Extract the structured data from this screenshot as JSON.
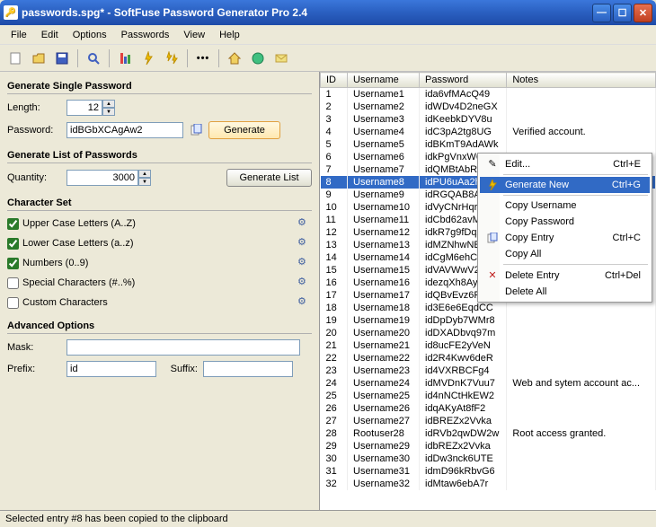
{
  "title": "passwords.spg* - SoftFuse Password Generator Pro 2.4",
  "menu": [
    "File",
    "Edit",
    "Options",
    "Passwords",
    "View",
    "Help"
  ],
  "single": {
    "header": "Generate Single Password",
    "lengthLabel": "Length:",
    "length": "12",
    "passLabel": "Password:",
    "password": "idBGbXCAgAw2",
    "generateBtn": "Generate"
  },
  "list": {
    "header": "Generate List of Passwords",
    "qtyLabel": "Quantity:",
    "qty": "3000",
    "generateBtn": "Generate List"
  },
  "charset": {
    "header": "Character Set",
    "upper": {
      "label": "Upper Case Letters (A..Z)",
      "checked": true
    },
    "lower": {
      "label": "Lower Case Letters (a..z)",
      "checked": true
    },
    "numbers": {
      "label": "Numbers (0..9)",
      "checked": true
    },
    "special": {
      "label": "Special Characters (#..%)",
      "checked": false
    },
    "custom": {
      "label": "Custom Characters",
      "checked": false
    }
  },
  "advanced": {
    "header": "Advanced Options",
    "maskLabel": "Mask:",
    "mask": "",
    "prefixLabel": "Prefix:",
    "prefix": "id",
    "suffixLabel": "Suffix:",
    "suffix": ""
  },
  "columns": [
    "ID",
    "Username",
    "Password",
    "Notes"
  ],
  "rows": [
    {
      "id": "1",
      "user": "Username1",
      "pass": "ida6vfMAcQ49",
      "notes": ""
    },
    {
      "id": "2",
      "user": "Username2",
      "pass": "idWDv4D2neGX",
      "notes": ""
    },
    {
      "id": "3",
      "user": "Username3",
      "pass": "idKeebkDYV8u",
      "notes": ""
    },
    {
      "id": "4",
      "user": "Username4",
      "pass": "idC3pA2tg8UG",
      "notes": "Verified account."
    },
    {
      "id": "5",
      "user": "Username5",
      "pass": "idBKmT9AdAWk",
      "notes": ""
    },
    {
      "id": "6",
      "user": "Username6",
      "pass": "idkPgVnxW6Wy",
      "notes": ""
    },
    {
      "id": "7",
      "user": "Username7",
      "pass": "idQMBtAbR8Wh",
      "notes": ""
    },
    {
      "id": "8",
      "user": "Username8",
      "pass": "idPU6uAa2hAA",
      "notes": "",
      "selected": true
    },
    {
      "id": "9",
      "user": "Username9",
      "pass": "idRGQAB8AaKB",
      "notes": ""
    },
    {
      "id": "10",
      "user": "Username10",
      "pass": "idVyCNrHqr96",
      "notes": ""
    },
    {
      "id": "11",
      "user": "Username11",
      "pass": "idCbd62avMkM",
      "notes": ""
    },
    {
      "id": "12",
      "user": "Username12",
      "pass": "idkR7g9fDqxn",
      "notes": ""
    },
    {
      "id": "13",
      "user": "Username13",
      "pass": "idMZNhwNEX7m",
      "notes": ""
    },
    {
      "id": "14",
      "user": "Username14",
      "pass": "idCgM6ehCmdY",
      "notes": ""
    },
    {
      "id": "15",
      "user": "Username15",
      "pass": "idVAVWwV2ac2",
      "notes": ""
    },
    {
      "id": "16",
      "user": "Username16",
      "pass": "idezqXh8AyDw",
      "notes": ""
    },
    {
      "id": "17",
      "user": "Username17",
      "pass": "idQBvEvz6Fpg",
      "notes": ""
    },
    {
      "id": "18",
      "user": "Username18",
      "pass": "id3E6e6EqdCC",
      "notes": ""
    },
    {
      "id": "19",
      "user": "Username19",
      "pass": "idDpDyb7WMr8",
      "notes": ""
    },
    {
      "id": "20",
      "user": "Username20",
      "pass": "idDXADbvq97m",
      "notes": ""
    },
    {
      "id": "21",
      "user": "Username21",
      "pass": "id8ucFE2yVeN",
      "notes": ""
    },
    {
      "id": "22",
      "user": "Username22",
      "pass": "id2R4Kwv6deR",
      "notes": ""
    },
    {
      "id": "23",
      "user": "Username23",
      "pass": "id4VXRBCFg4",
      "notes": ""
    },
    {
      "id": "24",
      "user": "Username24",
      "pass": "idMVDnK7Vuu7",
      "notes": "Web and sytem account ac..."
    },
    {
      "id": "25",
      "user": "Username25",
      "pass": "id4nNCtHkEW2",
      "notes": ""
    },
    {
      "id": "26",
      "user": "Username26",
      "pass": "idqAKyAt8fF2",
      "notes": ""
    },
    {
      "id": "27",
      "user": "Username27",
      "pass": "idBREZx2Vvka",
      "notes": ""
    },
    {
      "id": "28",
      "user": "Rootuser28",
      "pass": "idRVb2qwDW2w",
      "notes": "Root access granted."
    },
    {
      "id": "29",
      "user": "Username29",
      "pass": "idbREZx2Vvka",
      "notes": ""
    },
    {
      "id": "30",
      "user": "Username30",
      "pass": "idDw3nck6UTE",
      "notes": ""
    },
    {
      "id": "31",
      "user": "Username31",
      "pass": "idmD96kRbvG6",
      "notes": ""
    },
    {
      "id": "32",
      "user": "Username32",
      "pass": "idMtaw6ebA7r",
      "notes": ""
    }
  ],
  "contextMenu": {
    "edit": {
      "label": "Edit...",
      "shortcut": "Ctrl+E"
    },
    "generate": {
      "label": "Generate New",
      "shortcut": "Ctrl+G"
    },
    "copyUser": {
      "label": "Copy Username",
      "shortcut": ""
    },
    "copyPass": {
      "label": "Copy Password",
      "shortcut": ""
    },
    "copyEntry": {
      "label": "Copy Entry",
      "shortcut": "Ctrl+C"
    },
    "copyAll": {
      "label": "Copy All",
      "shortcut": ""
    },
    "delEntry": {
      "label": "Delete Entry",
      "shortcut": "Ctrl+Del"
    },
    "delAll": {
      "label": "Delete All",
      "shortcut": ""
    }
  },
  "status": "Selected entry #8 has been copied to the clipboard"
}
